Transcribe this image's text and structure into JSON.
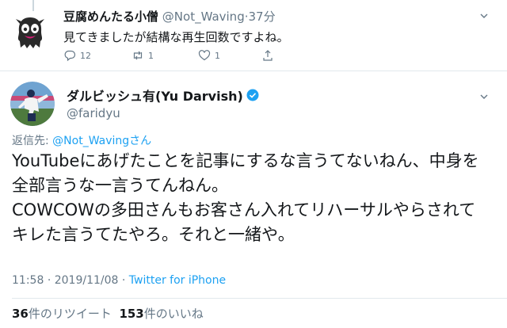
{
  "parent": {
    "display_name": "豆腐めんたる小僧",
    "handle": "@Not_Waving",
    "time": "37分",
    "separator": "·",
    "text": "見てきましたが結構な再生回数ですよね。",
    "reply_count": "12",
    "retweet_count": "1",
    "like_count": "1",
    "icons": [
      "reply-icon",
      "retweet-icon",
      "like-icon",
      "share-icon",
      "chevron-down-icon"
    ]
  },
  "tweet": {
    "display_name": "ダルビッシュ有(Yu Darvish)",
    "handle": "@faridyu",
    "replying_label": "返信先:",
    "replying_to": "@Not_Wavingさん",
    "body_lines": [
      "YouTubeにあげたことを記事にするな言うてないねん、中身を",
      "全部言うな一言うてんねん。",
      "COWCOWの多田さんもお客さん入れてリハーサルやらされて",
      "キレた言うてたやろ。それと一緒や。"
    ],
    "time": "11:58",
    "date": "2019/11/08",
    "meta_sep": "·",
    "source": "Twitter for iPhone",
    "retweets_value": "36",
    "retweets_label": "件のリツイート",
    "likes_value": "153",
    "likes_label": "件のいいね"
  },
  "colors": {
    "link": "#1da1f2",
    "secondary": "#657786",
    "text": "#14171a",
    "divider": "#e1e8ed",
    "verified": "#1da1f2",
    "monster": "#2a2a2a",
    "monster_accent": "#d81e78"
  }
}
